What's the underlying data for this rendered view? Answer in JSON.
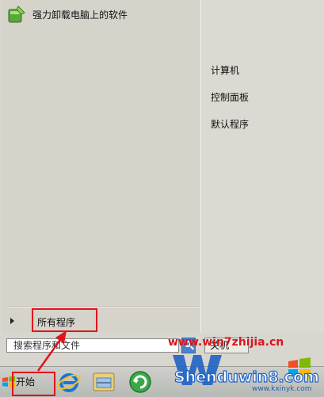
{
  "pinned_programs": [
    {
      "label": "强力卸载电脑上的软件",
      "icon": "uninstall-app-icon"
    }
  ],
  "all_programs": {
    "label": "所有程序",
    "icon": "triangle-arrow-icon"
  },
  "right_pane": {
    "items": [
      {
        "label": "计算机"
      },
      {
        "label": "控制面板"
      },
      {
        "label": "默认程序"
      }
    ]
  },
  "search": {
    "value": "搜索程序和文件",
    "icon": "search-icon"
  },
  "shutdown": {
    "label": "关机"
  },
  "taskbar": {
    "start_label": "开始",
    "pinned_icons": [
      "internet-explorer-icon",
      "file-explorer-icon",
      "browser-refresh-icon"
    ]
  },
  "watermark": {
    "url_top": "www.win7zhijia.cn",
    "logo_text": "Shenduwin8.com",
    "url_bottom": "www.kxinyk.com"
  },
  "colors": {
    "annotation_red": "#e0141b",
    "menu_bg": "#d9d6cf",
    "watermark_blue": "#1e63c4",
    "watermark_red": "#d7161f"
  }
}
